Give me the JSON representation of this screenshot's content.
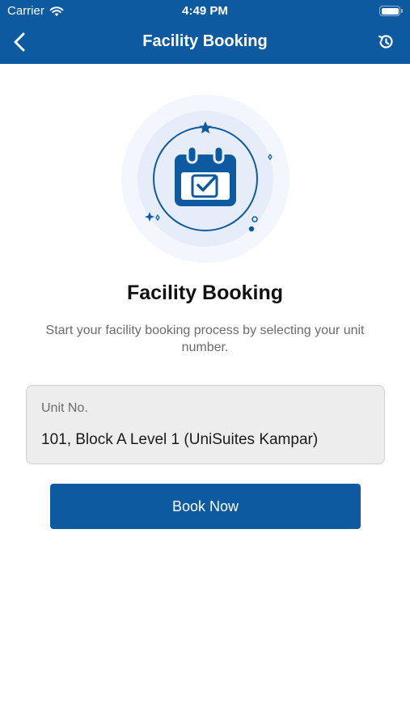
{
  "status_bar": {
    "carrier": "Carrier",
    "time": "4:49 PM"
  },
  "nav": {
    "title": "Facility Booking",
    "back_icon": "chevron-left-icon",
    "history_icon": "history-icon"
  },
  "illustration": {
    "icon": "calendar-check-icon"
  },
  "main": {
    "title": "Facility Booking",
    "subtitle": "Start your facility booking process by selecting your unit number."
  },
  "unit_field": {
    "label": "Unit No.",
    "value": "101, Block A Level 1 (UniSuites Kampar)"
  },
  "book_button": {
    "label": "Book Now"
  },
  "colors": {
    "brand": "#0d5aa0",
    "illustration_bg": "#eef3fb"
  }
}
